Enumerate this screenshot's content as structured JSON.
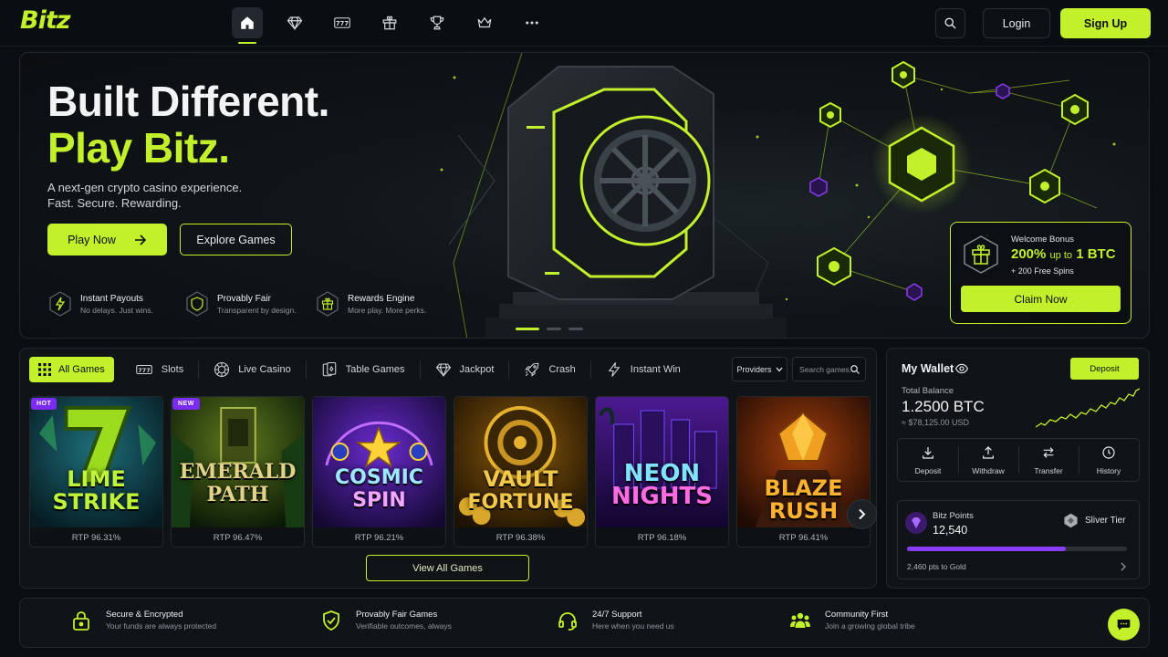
{
  "brand": {
    "logo": "Bitz",
    "accent": "#c2f02a",
    "background": "#0c0f12"
  },
  "nav": {
    "icons": [
      "home-icon",
      "diamond-icon",
      "slots-777-icon",
      "gift-icon",
      "trophy-icon",
      "crown-icon",
      "more-icon"
    ],
    "active": "home-icon",
    "login_label": "Login",
    "signup_label": "Sign Up"
  },
  "hero": {
    "title_line1": "Built Different.",
    "title_line2": "Play Bitz.",
    "subtitle_line1": "A next-gen crypto casino experience.",
    "subtitle_line2": "Fast. Secure. Rewarding.",
    "play_label": "Play Now",
    "explore_label": "Explore Games",
    "features": [
      {
        "icon": "bolt-icon",
        "title": "Instant Payouts",
        "subtitle": "No delays. Just wins."
      },
      {
        "icon": "shield-icon",
        "title": "Provably Fair",
        "subtitle": "Transparent by design."
      },
      {
        "icon": "gift-icon",
        "title": "Rewards Engine",
        "subtitle": "More play. More perks."
      }
    ],
    "slides_total": 3,
    "slide_active": 1,
    "bonus": {
      "label": "Welcome Bonus",
      "percent": "200%",
      "upto": "up to",
      "amount": "1 BTC",
      "extra": "+ 200 Free Spins",
      "claim_label": "Claim Now"
    }
  },
  "games": {
    "tabs": [
      {
        "label": "All Games",
        "icon": "grid-icon",
        "active": true
      },
      {
        "label": "Slots",
        "icon": "slots-777-icon",
        "active": false
      },
      {
        "label": "Live Casino",
        "icon": "chip-icon",
        "active": false
      },
      {
        "label": "Table Games",
        "icon": "cards-icon",
        "active": false
      },
      {
        "label": "Jackpot",
        "icon": "diamond-icon",
        "active": false
      },
      {
        "label": "Crash",
        "icon": "rocket-icon",
        "active": false
      },
      {
        "label": "Instant Win",
        "icon": "bolt-icon",
        "active": false
      }
    ],
    "providers_label": "Providers",
    "search_placeholder": "Search games...",
    "cards": [
      {
        "line1": "LIME",
        "line2": "STRIKE",
        "rtp": "RTP 96.31%",
        "badge": "HOT",
        "badge_color": "#7b2cf3"
      },
      {
        "line1": "EMERALD",
        "line2": "PATH",
        "rtp": "RTP 96.47%",
        "badge": "NEW",
        "badge_color": "#7b2cf3"
      },
      {
        "line1": "COSMIC",
        "line2": "SPIN",
        "rtp": "RTP 96.21%",
        "badge": "",
        "badge_color": ""
      },
      {
        "line1": "VAULT",
        "line2": "FORTUNE",
        "rtp": "RTP 96.38%",
        "badge": "",
        "badge_color": ""
      },
      {
        "line1": "NEON",
        "line2": "NIGHTS",
        "rtp": "RTP 96.18%",
        "badge": "",
        "badge_color": ""
      },
      {
        "line1": "BLAZE",
        "line2": "RUSH",
        "rtp": "RTP 96.41%",
        "badge": "",
        "badge_color": ""
      }
    ],
    "view_all_label": "View All Games"
  },
  "wallet": {
    "title": "My Wallet",
    "deposit_label": "Deposit",
    "balance_label": "Total Balance",
    "balance": "1.2500 BTC",
    "balance_fiat": "≈ $78,125.00 USD",
    "actions": [
      {
        "label": "Deposit",
        "icon": "download-icon"
      },
      {
        "label": "Withdraw",
        "icon": "upload-icon"
      },
      {
        "label": "Transfer",
        "icon": "transfer-icon"
      },
      {
        "label": "History",
        "icon": "clock-icon"
      }
    ],
    "points_label": "Bitz Points",
    "points_value": "12,540",
    "tier": "Sliver Tier",
    "progress": 0.72,
    "progress_text": "2,460 pts to Gold"
  },
  "trust": [
    {
      "icon": "lock-icon",
      "title": "Secure & Encrypted",
      "subtitle": "Your funds are always protected"
    },
    {
      "icon": "shield-check-icon",
      "title": "Provably Fair Games",
      "subtitle": "Verifiable outcomes, always"
    },
    {
      "icon": "headset-icon",
      "title": "24/7 Support",
      "subtitle": "Here when you need us"
    },
    {
      "icon": "community-icon",
      "title": "Community First",
      "subtitle": "Join a growing global tribe"
    }
  ]
}
